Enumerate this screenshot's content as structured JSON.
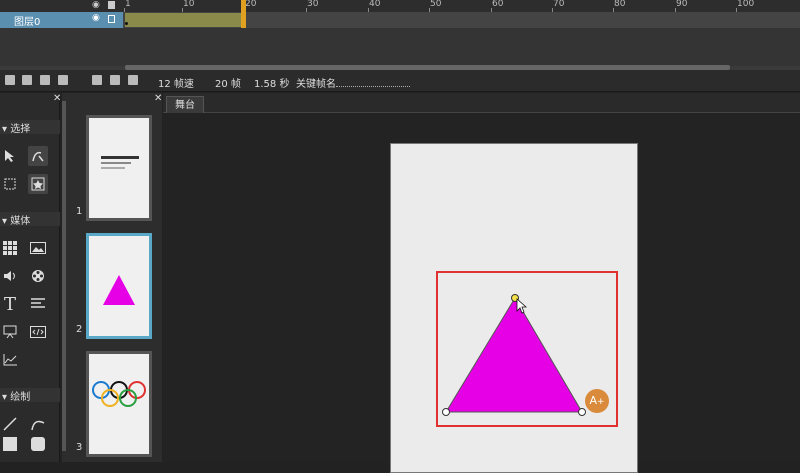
{
  "timeline": {
    "ruler_ticks": [
      "1",
      "10",
      "20",
      "30",
      "40",
      "50",
      "60",
      "70",
      "80",
      "90",
      "100"
    ],
    "layer_name": "图层0"
  },
  "statusbar": {
    "fps": "12 帧速",
    "frames": "20 帧",
    "duration": "1.58 秒",
    "keyframe_name_label": "关键帧名"
  },
  "tools": {
    "section_select": "▾ 选择",
    "section_media": "▾ 媒体",
    "section_draw": "▾ 绘制"
  },
  "slides": [
    {
      "num": "1"
    },
    {
      "num": "2"
    },
    {
      "num": "3"
    }
  ],
  "stage": {
    "tab_label": "舞台"
  },
  "colors": {
    "triangle_fill": "#e600e6",
    "selection_border": "#e03030",
    "accent_blue": "#5aa8c8",
    "add_badge": "#d98a3a"
  }
}
